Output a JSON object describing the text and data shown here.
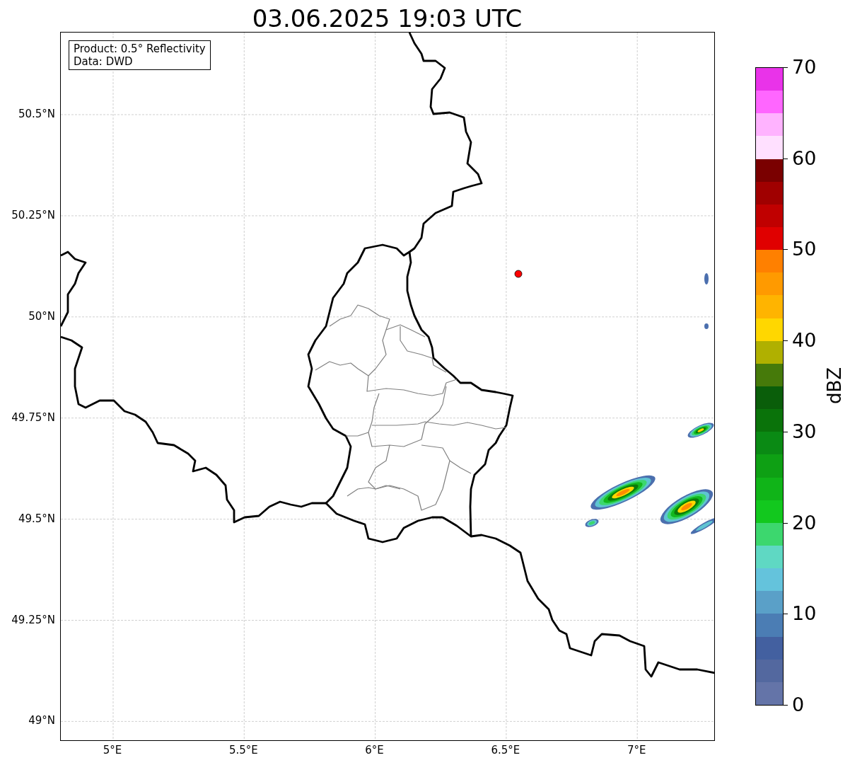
{
  "title": "03.06.2025 19:03 UTC",
  "legend": [
    "Product: 0.5° Reflectivity",
    "Data: DWD"
  ],
  "map": {
    "y_ticks": [
      "50.5°N",
      "50.25°N",
      "50°N",
      "49.75°N",
      "49.5°N",
      "49.25°N",
      "49°N"
    ],
    "x_ticks": [
      "5°E",
      "5.5°E",
      "6°E",
      "6.5°E",
      "7°E"
    ]
  },
  "colorbar": {
    "label": "dBZ",
    "ticks": [
      "70",
      "60",
      "50",
      "40",
      "30",
      "20",
      "10",
      "0"
    ],
    "bands": [
      {
        "color": "#6474a8"
      },
      {
        "color": "#53689f"
      },
      {
        "color": "#4360a0"
      },
      {
        "color": "#4b7db4"
      },
      {
        "color": "#5aa0c8"
      },
      {
        "color": "#64c3dc"
      },
      {
        "color": "#5fd8c3"
      },
      {
        "color": "#3cd76e"
      },
      {
        "color": "#12c81e"
      },
      {
        "color": "#10b418"
      },
      {
        "color": "#0ea014"
      },
      {
        "color": "#0a8a14"
      },
      {
        "color": "#0a730a"
      },
      {
        "color": "#0a5e0a"
      },
      {
        "color": "#467a0a"
      },
      {
        "color": "#b0b000"
      },
      {
        "color": "#ffd700"
      },
      {
        "color": "#ffb400"
      },
      {
        "color": "#ff9a00"
      },
      {
        "color": "#ff8000"
      },
      {
        "color": "#e00000"
      },
      {
        "color": "#c00000"
      },
      {
        "color": "#a00000"
      },
      {
        "color": "#7a0000"
      },
      {
        "color": "#ffe0ff"
      },
      {
        "color": "#ffb3ff"
      },
      {
        "color": "#ff66ff"
      },
      {
        "color": "#e933e9"
      }
    ]
  }
}
